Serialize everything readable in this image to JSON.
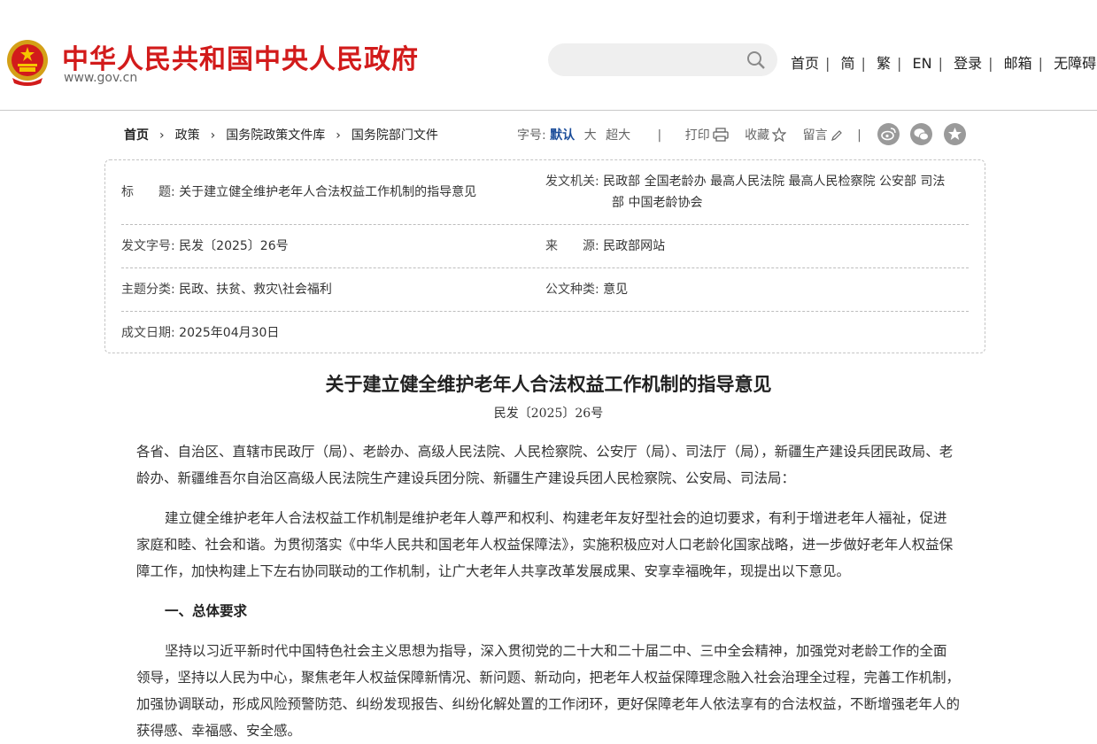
{
  "header": {
    "site_title": "中华人民共和国中央人民政府",
    "site_domain": "www.gov.cn",
    "search_placeholder": "",
    "nav": [
      "首页",
      "简",
      "繁",
      "EN",
      "登录",
      "邮箱",
      "无障碍"
    ]
  },
  "breadcrumb": [
    "首页",
    "政策",
    "国务院政策文件库",
    "国务院部门文件"
  ],
  "tools": {
    "font_size_label": "字号:",
    "font_sizes": [
      "默认",
      "大",
      "超大"
    ],
    "print_label": "打印",
    "favorite_label": "收藏",
    "comment_label": "留言"
  },
  "info": {
    "title_label": "标　　题:",
    "title_value": "关于建立健全维护老年人合法权益工作机制的指导意见",
    "issuer_label": "发文机关:",
    "issuer_value_line1": "民政部 全国老龄办 最高人民法院 最高人民检察院 公安部 司法",
    "issuer_value_line2": "部 中国老龄协会",
    "docno_label": "发文字号:",
    "docno_value": "民发〔2025〕26号",
    "source_label": "来　　源:",
    "source_value": "民政部网站",
    "topic_label": "主题分类:",
    "topic_value": "民政、扶贫、救灾\\社会福利",
    "type_label": "公文种类:",
    "type_value": "意见",
    "date_label": "成文日期:",
    "date_value": "2025年04月30日"
  },
  "article": {
    "title": "关于建立健全维护老年人合法权益工作机制的指导意见",
    "doc_no": "民发〔2025〕26号",
    "addressee": "各省、自治区、直辖市民政厅（局）、老龄办、高级人民法院、人民检察院、公安厅（局）、司法厅（局），新疆生产建设兵团民政局、老龄办、新疆维吾尔自治区高级人民法院生产建设兵团分院、新疆生产建设兵团人民检察院、公安局、司法局：",
    "intro": "建立健全维护老年人合法权益工作机制是维护老年人尊严和权利、构建老年友好型社会的迫切要求，有利于增进老年人福祉，促进家庭和睦、社会和谐。为贯彻落实《中华人民共和国老年人权益保障法》，实施积极应对人口老龄化国家战略，进一步做好老年人权益保障工作，加快构建上下左右协同联动的工作机制，让广大老年人共享改革发展成果、安享幸福晚年，现提出以下意见。",
    "section1_heading": "一、总体要求",
    "section1_body": "坚持以习近平新时代中国特色社会主义思想为指导，深入贯彻党的二十大和二十届二中、三中全会精神，加强党对老龄工作的全面领导，坚持以人民为中心，聚焦老年人权益保障新情况、新问题、新动向，把老年人权益保障理念融入社会治理全过程，完善工作机制，加强协调联动，形成风险预警防范、纠纷发现报告、纠纷化解处置的工作闭环，更好保障老年人依法享有的合法权益，不断增强老年人的获得感、幸福感、安全感。"
  },
  "colors": {
    "brand_red": "#d21b1b",
    "active_blue": "#1d4e9a"
  }
}
